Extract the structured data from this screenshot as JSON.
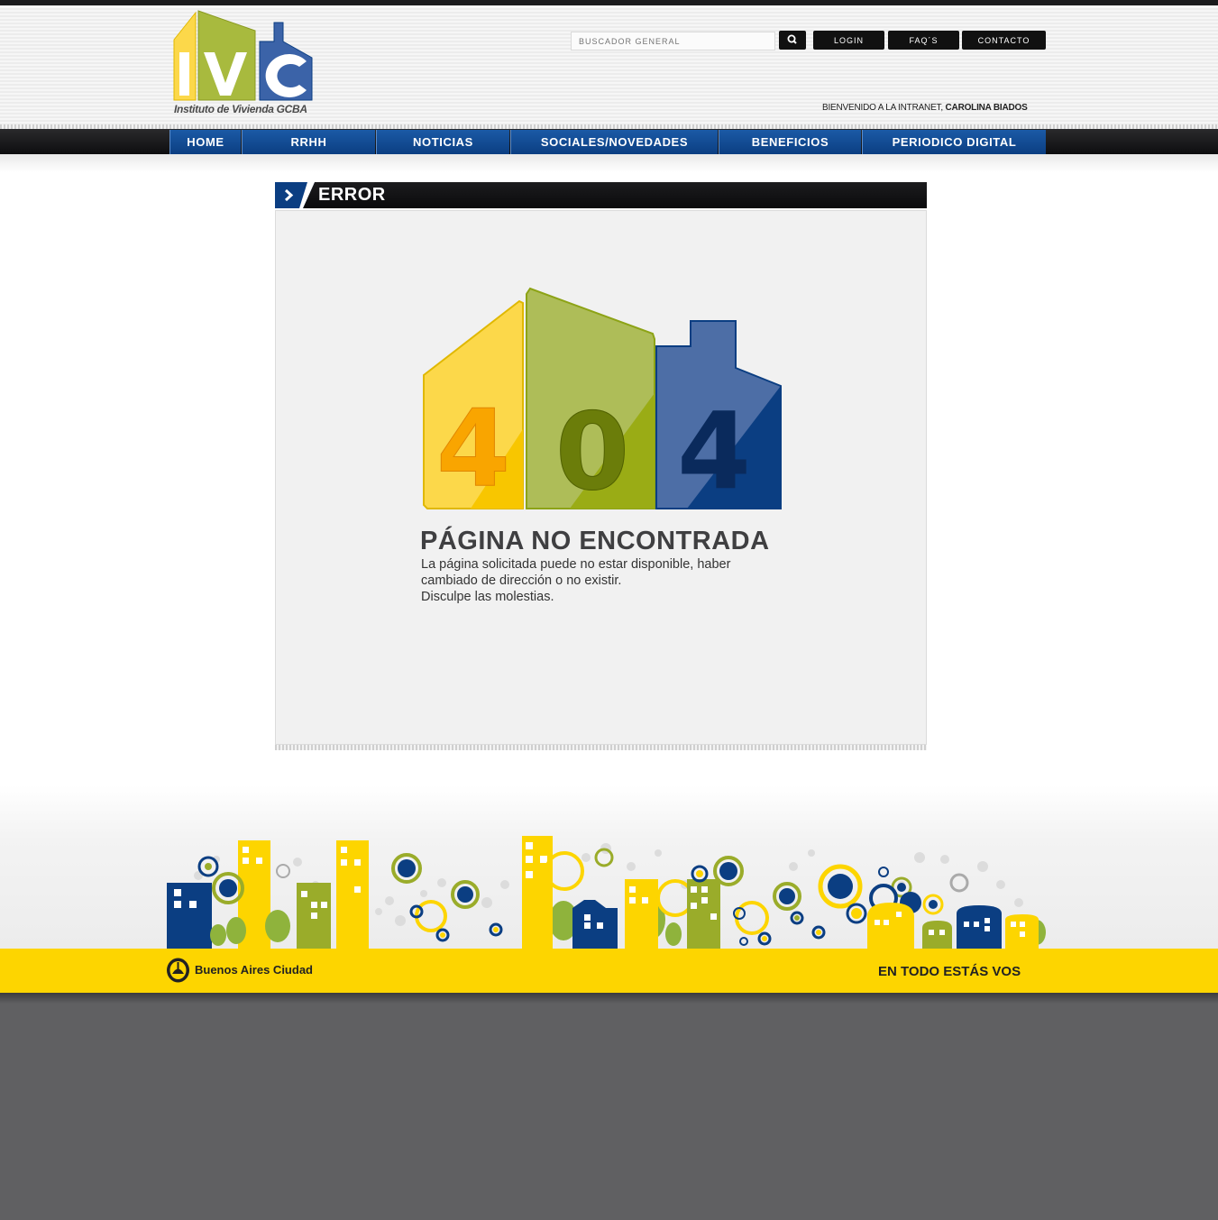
{
  "header": {
    "logo_caption": "Instituto de Vivienda GCBA",
    "search_placeholder": "BUSCADOR GENERAL",
    "buttons": [
      "LOGIN",
      "FAQ´S",
      "CONTACTO"
    ],
    "welcome_prefix": "BIENVENIDO A LA INTRANET,",
    "welcome_user": "CAROLINA BIADOS"
  },
  "nav": {
    "items": [
      "HOME",
      "RRHH",
      "NOTICIAS",
      "SOCIALES/NOVEDADES",
      "BENEFICIOS",
      "PERIODICO DIGITAL"
    ]
  },
  "panel": {
    "title": "ERROR",
    "code_digits": [
      "4",
      "0",
      "4"
    ],
    "heading": "PÁGINA NO ENCONTRADA",
    "message_lines": [
      "La página solicitada puede no estar disponible, haber",
      "cambiado de dirección o no existir.",
      "Disculpe las molestias."
    ]
  },
  "footer": {
    "city_name": "Buenos Aires Ciudad",
    "slogan": "EN TODO ESTÁS VOS"
  },
  "colors": {
    "yellow": "#fdd500",
    "green": "#9aac2a",
    "blue": "#0b3e82",
    "dark": "#111111"
  },
  "icons": [
    "search-icon",
    "chevron-right-icon",
    "buenos-aires-seal-icon"
  ]
}
